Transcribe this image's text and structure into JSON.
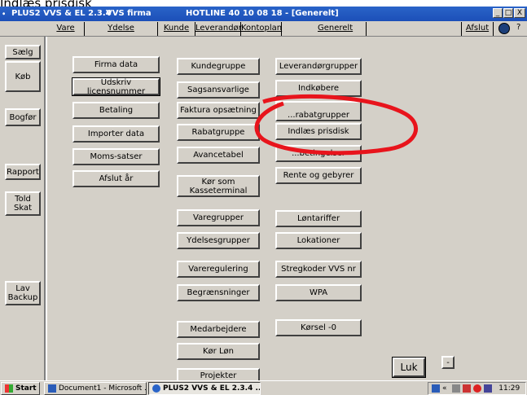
{
  "caption": "Indlæs prisdisk",
  "title": {
    "app": "PLUS2 VVS & EL 2.3.4",
    "firma": "VVS firma",
    "hotline": "HOTLINE 40 10 08 18 - [Generelt]"
  },
  "menu": [
    "Vare",
    "Ydelse",
    "Kunde",
    "Leverandør",
    "Kontoplan",
    "Generelt"
  ],
  "menu_right": "Afslut",
  "help": "?",
  "window_buttons": [
    "_",
    "□",
    "X"
  ],
  "left": [
    "Sælg",
    "Køb",
    "Bogfør",
    "Rapport",
    "Told Skat",
    "Lav Backup"
  ],
  "col1": [
    "Firma data",
    "Udskriv licensnummer",
    "Betaling",
    "Importer data",
    "Moms-satser",
    "Afslut år"
  ],
  "col2": [
    "Kundegruppe",
    "Sagsansvarlige",
    "Faktura opsætning",
    "Rabatgruppe",
    "Avancetabel",
    "Kør som Kasseterminal",
    "Varegrupper",
    "Ydelsesgrupper",
    "Vareregulering",
    "Begrænsninger",
    "Medarbejdere",
    "Kør Løn",
    "Projekter"
  ],
  "col3": [
    "Leverandørgrupper",
    "Indkøbere",
    "...rabatgrupper",
    "Indlæs prisdisk",
    "...betingelser",
    "Rente og gebyrer",
    "Løntariffer",
    "Lokationer",
    "Stregkoder VVS nr",
    "WPA",
    "Kørsel -0"
  ],
  "luk": "Luk",
  "small": "-",
  "taskbar": {
    "start": "Start",
    "doc": "Document1 - Microsoft ...",
    "app": "PLUS2 VVS & EL 2.3.4 ...",
    "tray": "«",
    "time": "11:29"
  },
  "colors": {
    "title": "#1c4fb8",
    "face": "#d4d0c8",
    "circle": "#e8141c"
  }
}
